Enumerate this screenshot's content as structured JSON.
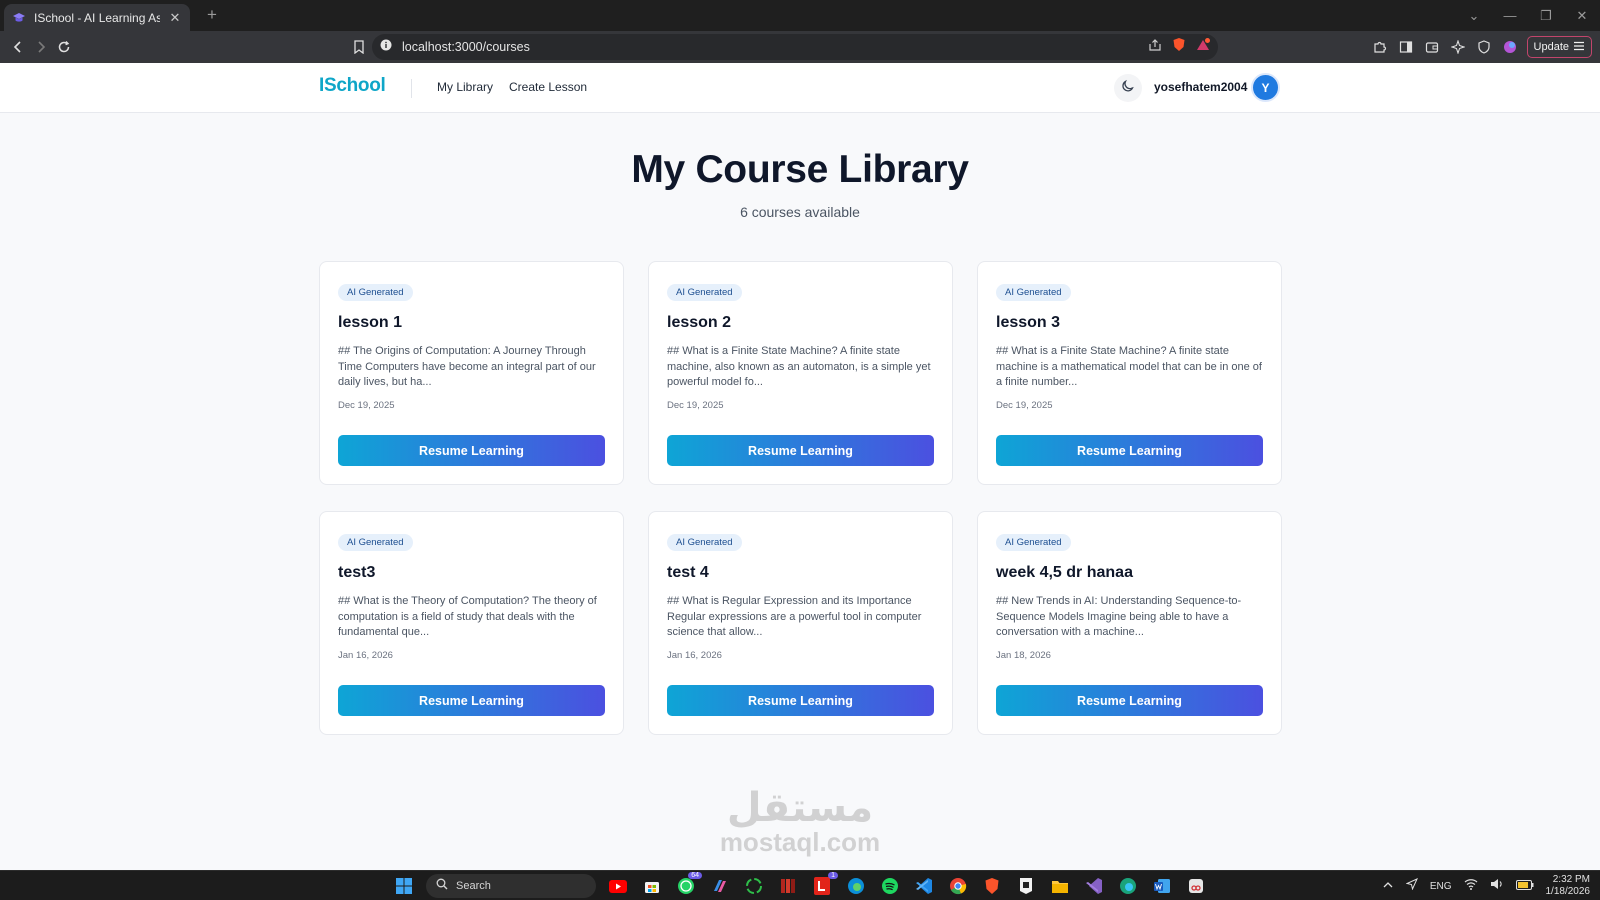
{
  "browser": {
    "tab_title": "ISchool - AI Learning Assistant",
    "tab_close": "✕",
    "new_tab": "+",
    "url": "localhost:3000/courses",
    "update_label": "Update",
    "window_controls": [
      "⌄",
      "—",
      "❐",
      "✕"
    ]
  },
  "header": {
    "logo": "ISchool",
    "nav": [
      "My Library",
      "Create Lesson"
    ],
    "username": "yosefhatem2004",
    "avatar_letter": "Y"
  },
  "page": {
    "title": "My Course Library",
    "subtitle": "6 courses available"
  },
  "courses": [
    {
      "badge": "AI Generated",
      "title": "lesson 1",
      "description": "## The Origins of Computation: A Journey Through Time Computers have become an integral part of our daily lives, but ha...",
      "date": "Dec 19, 2025",
      "button": "Resume Learning"
    },
    {
      "badge": "AI Generated",
      "title": "lesson 2",
      "description": "## What is a Finite State Machine? A finite state machine, also known as an automaton, is a simple yet powerful model fo...",
      "date": "Dec 19, 2025",
      "button": "Resume Learning"
    },
    {
      "badge": "AI Generated",
      "title": "lesson 3",
      "description": "## What is a Finite State Machine? A finite state machine is a mathematical model that can be in one of a finite number...",
      "date": "Dec 19, 2025",
      "button": "Resume Learning"
    },
    {
      "badge": "AI Generated",
      "title": "test3",
      "description": "## What is the Theory of Computation? The theory of computation is a field of study that deals with the fundamental que...",
      "date": "Jan 16, 2026",
      "button": "Resume Learning"
    },
    {
      "badge": "AI Generated",
      "title": "test 4",
      "description": "## What is Regular Expression and its Importance Regular expressions are a powerful tool in computer science that allow...",
      "date": "Jan 16, 2026",
      "button": "Resume Learning"
    },
    {
      "badge": "AI Generated",
      "title": "week 4,5 dr hanaa",
      "description": "## New Trends in AI: Understanding Sequence-to-Sequence Models Imagine being able to have a conversation with a machine...",
      "date": "Jan 18, 2026",
      "button": "Resume Learning"
    }
  ],
  "watermark": {
    "arabic": "مستقل",
    "latin": "mostaql.com"
  },
  "taskbar": {
    "search_label": "Search",
    "whatsapp_badge": "64",
    "pdf_badge": "1",
    "language": "ENG",
    "time": "2:32 PM",
    "date": "1/18/2026"
  },
  "colors": {
    "logo": "#0fa6c8",
    "button_gradient_start": "#0ea5d6",
    "button_gradient_end": "#4b50e0",
    "avatar": "#1f7ae0",
    "badge_bg": "#e6f0fb"
  }
}
